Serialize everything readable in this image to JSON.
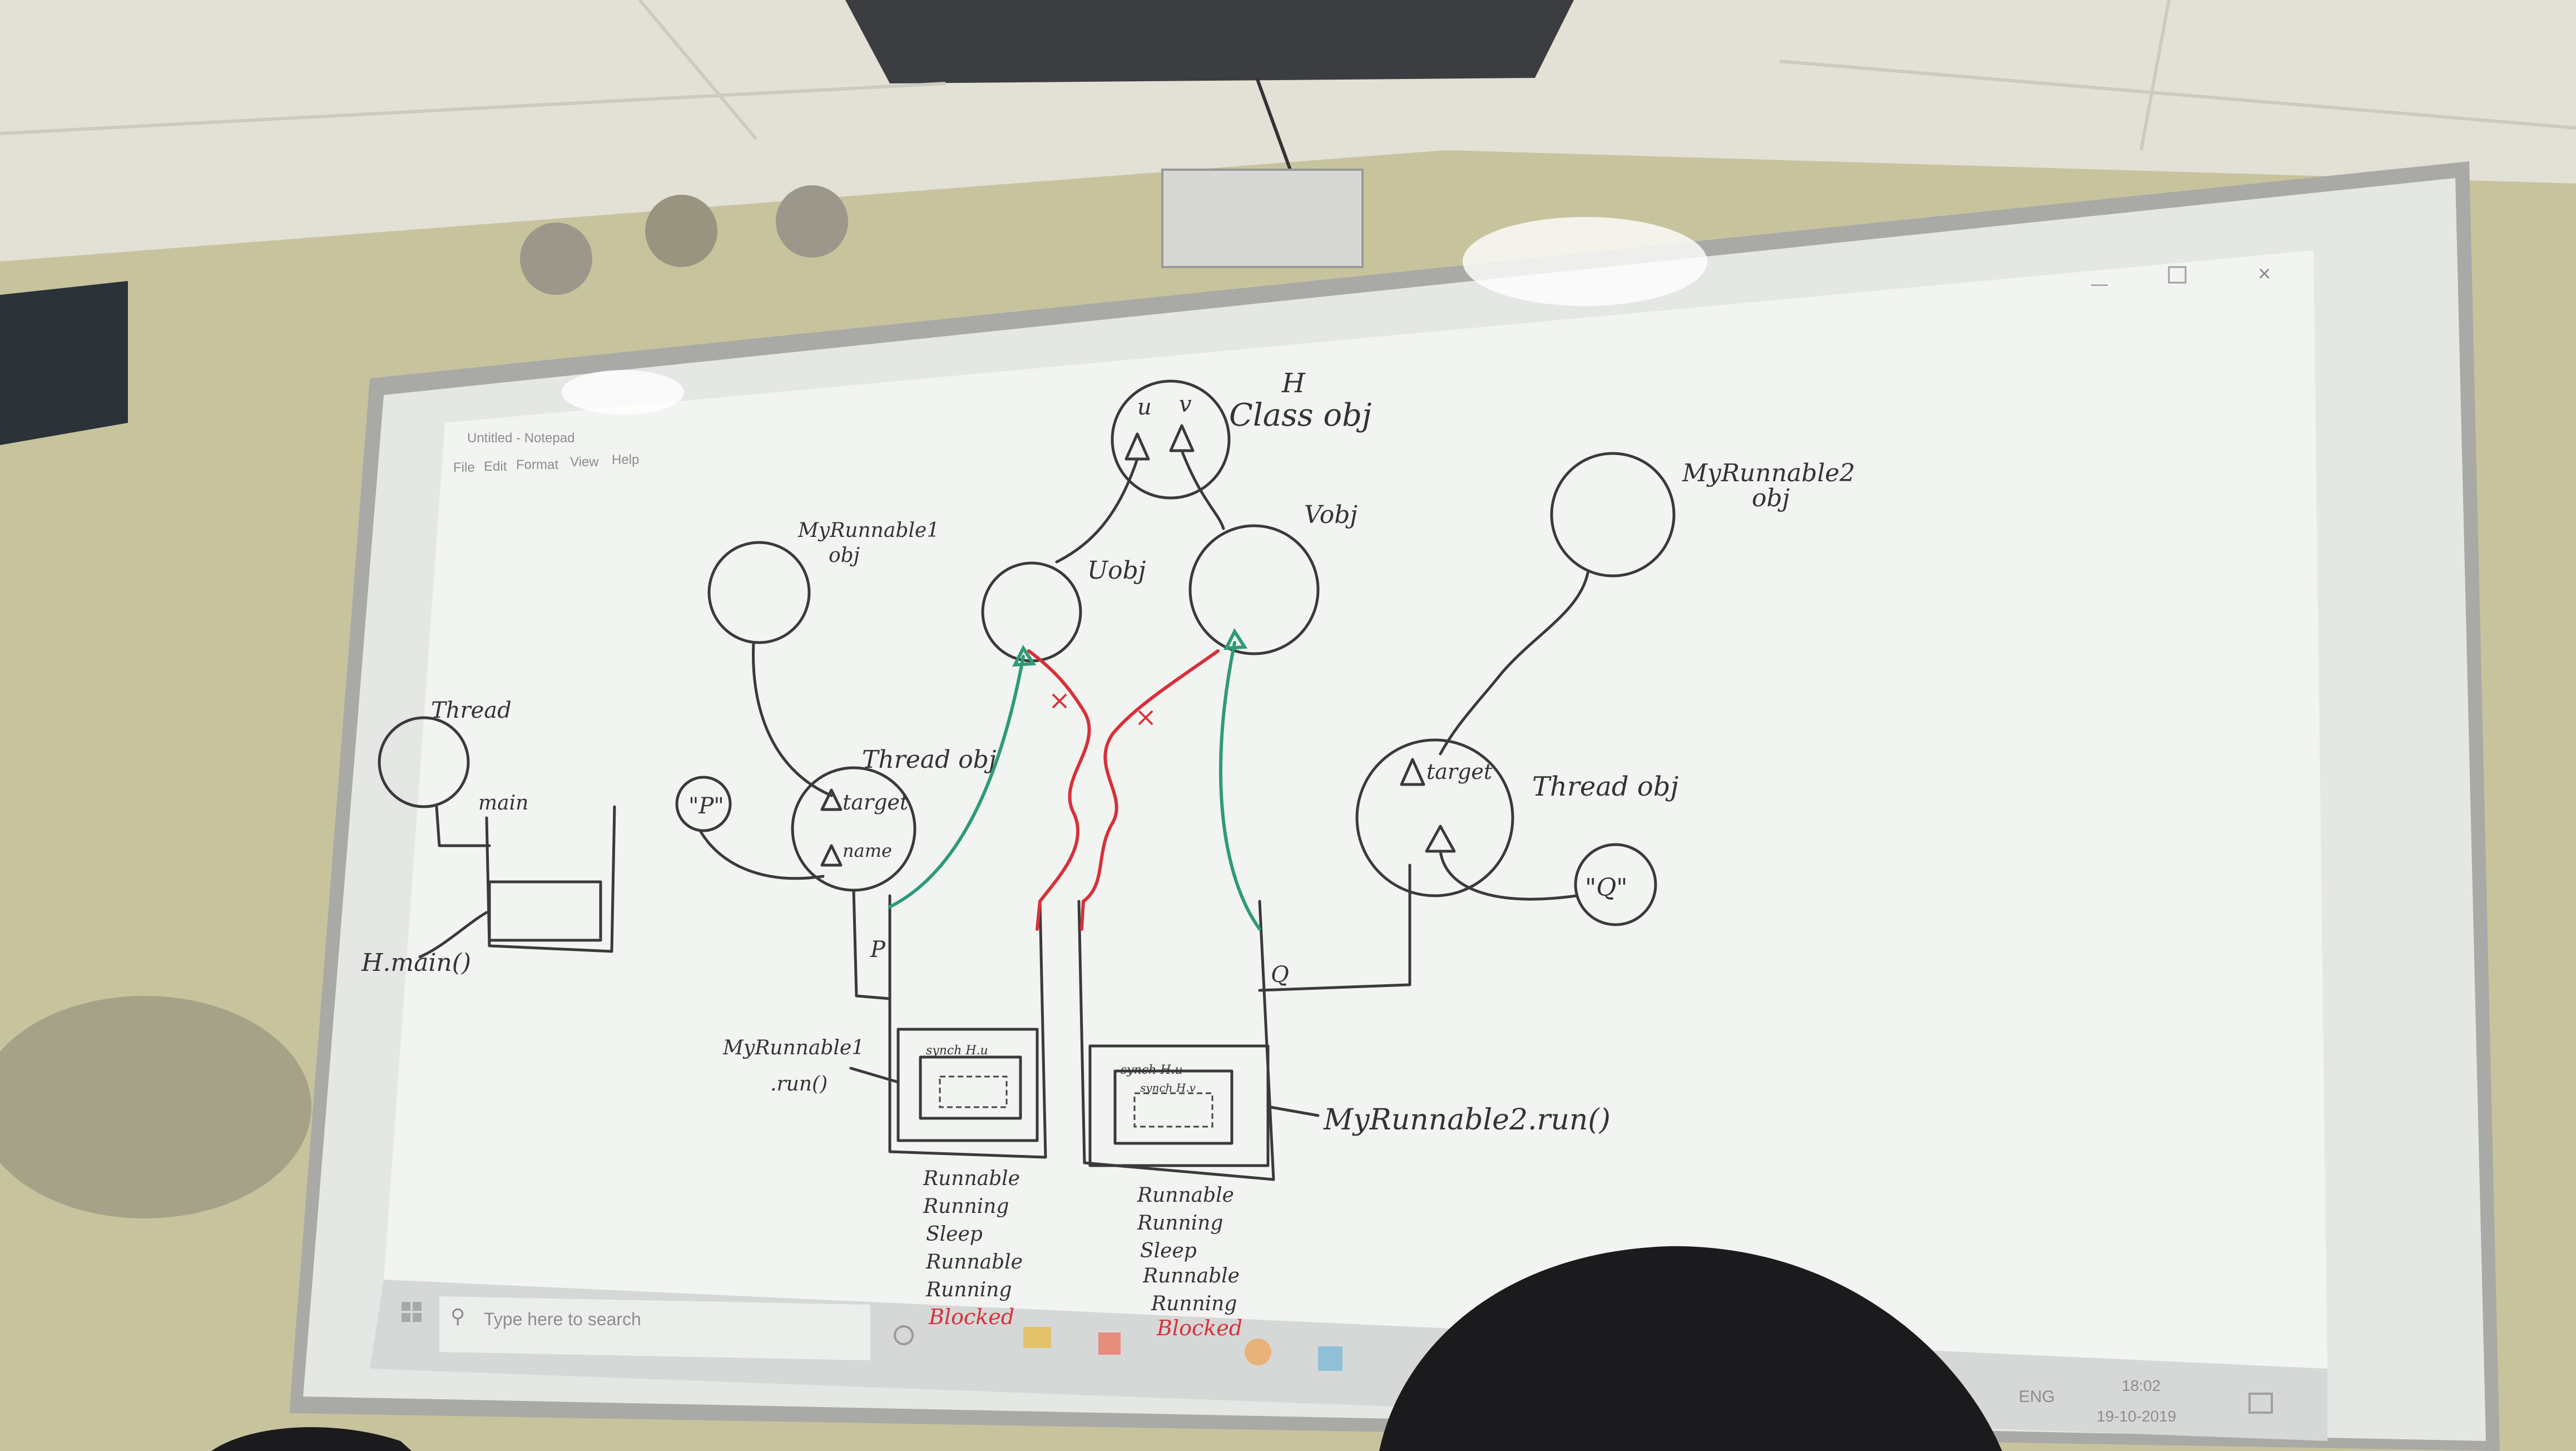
{
  "projected_screen": {
    "notepad_title": "Untitled - Notepad",
    "menu": [
      "File",
      "Edit",
      "Format",
      "View",
      "Help"
    ],
    "taskbar_search_placeholder": "Type here to search",
    "tray_language": "ENG",
    "tray_time": "18:02",
    "tray_date": "19-10-2019"
  },
  "whiteboard": {
    "class_obj": {
      "badge": "H",
      "label": "Class obj",
      "fields": [
        "u",
        "v"
      ]
    },
    "u_obj": "Uobj",
    "v_obj": "Vobj",
    "runnable1_obj": [
      "MyRunnable1",
      "obj"
    ],
    "runnable2_obj": [
      "MyRunnable2",
      "obj"
    ],
    "thread_obj_left": {
      "label": "Thread obj",
      "fields": [
        "target",
        "name"
      ],
      "name_value": "\"P\""
    },
    "thread_obj_right": {
      "label": "Thread obj",
      "field": "target",
      "name_value": "\"Q\""
    },
    "main_thread": {
      "label": "Thread",
      "stack_label": "main",
      "frame_label": "H.main()"
    },
    "stack_p_label": "P",
    "stack_q_label": "Q",
    "run1_label": [
      "MyRunnable1",
      ".run()"
    ],
    "run2_label": "MyRunnable2.run()",
    "frame_inner_label": "synch H.u",
    "frame_inner2_label": "synch H.v",
    "states_left": [
      "Runnable",
      "Running",
      "Sleep",
      "Runnable",
      "Running"
    ],
    "states_left_blocked": "Blocked",
    "states_right": [
      "Runnable",
      "Running",
      "Sleep",
      "Runnable",
      "Running"
    ],
    "states_right_blocked": "Blocked",
    "cross_mark": "×"
  }
}
